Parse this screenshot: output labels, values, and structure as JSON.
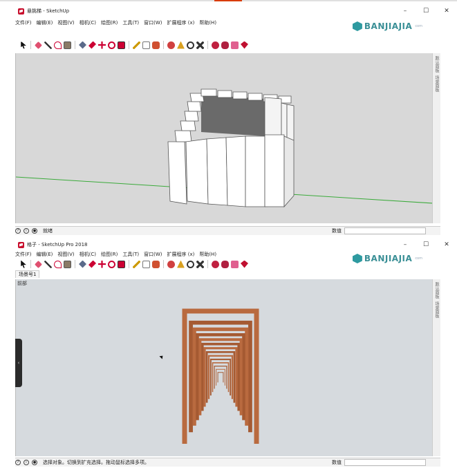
{
  "windows": [
    {
      "title": "悬挑梯 - SketchUp",
      "menus": [
        "文件(F)",
        "编辑(E)",
        "视图(V)",
        "相机(C)",
        "绘图(R)",
        "工具(T)",
        "窗口(W)",
        "扩展程序 (x)",
        "帮助(H)"
      ],
      "brand": "BANJIAJIA",
      "brand_sub": "com",
      "right_panel_tabs": [
        "默认面板",
        "场景面板"
      ],
      "status_text": "就绪",
      "measure_label": "数值"
    },
    {
      "title": "格子 - SketchUp Pro 2018",
      "menus": [
        "文件(F)",
        "编辑(E)",
        "视图(V)",
        "相机(C)",
        "绘图(R)",
        "工具(T)",
        "窗口(W)",
        "扩展程序 (x)",
        "帮助(H)"
      ],
      "brand": "BANJIAJIA",
      "brand_sub": "com",
      "scene_tab": "场景号1",
      "view_label": "前部",
      "right_panel_tabs": [
        "默认面板",
        "场景面板"
      ],
      "status_text": "选择对象。切换到扩充选择。拖动鼠标选择多项。",
      "measure_label": "数值"
    }
  ],
  "window_controls": [
    "–",
    "☐",
    "✕"
  ],
  "colors": {
    "accent_red": "#c8102e",
    "brand_teal": "#3a8f96",
    "axis_green": "#3aaa3a",
    "wood": "#b96a3f"
  }
}
